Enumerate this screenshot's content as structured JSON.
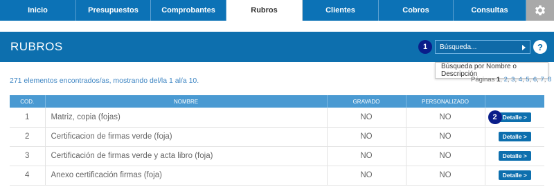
{
  "nav": {
    "tabs": [
      {
        "label": "Inicio"
      },
      {
        "label": "Presupuestos"
      },
      {
        "label": "Comprobantes"
      },
      {
        "label": "Rubros"
      },
      {
        "label": "Clientes"
      },
      {
        "label": "Cobros"
      },
      {
        "label": "Consultas"
      }
    ],
    "active_tab": "Rubros",
    "settings_icon": "gear-icon"
  },
  "header": {
    "title": "RUBROS",
    "badge_1": "1",
    "search_label": "Búsqueda...",
    "help_label": "?"
  },
  "dropdown": {
    "option": "Búsqueda por Nombre o Descripción"
  },
  "summary": "271 elementos encontrados/as, mostrando del/la 1 al/a 10.",
  "pagination": {
    "label": "Páginas",
    "current": "1",
    "pages": [
      "2",
      "3",
      "4",
      "5",
      "6",
      "7",
      "8"
    ]
  },
  "table": {
    "columns": [
      "COD.",
      "NOMBRE",
      "GRAVADO",
      "PERSONALIZADO",
      ""
    ],
    "rows": [
      {
        "cod": "1",
        "nombre": "Matriz, copia (fojas)",
        "gravado": "NO",
        "personalizado": "NO",
        "action": "Detalle >"
      },
      {
        "cod": "2",
        "nombre": "Certificacion de firmas verde (foja)",
        "gravado": "NO",
        "personalizado": "NO",
        "action": "Detalle >"
      },
      {
        "cod": "3",
        "nombre": "Certificación de firmas verde y acta libro (foja)",
        "gravado": "NO",
        "personalizado": "NO",
        "action": "Detalle >"
      },
      {
        "cod": "4",
        "nombre": "Anexo certificación firmas (foja)",
        "gravado": "NO",
        "personalizado": "NO",
        "action": "Detalle >"
      }
    ],
    "badge_2": "2"
  },
  "colors": {
    "nav_blue": "#0c72b6",
    "header_blue": "#0d6fae",
    "table_header_blue": "#4a9ad2",
    "badge_navy": "#0a1d8a",
    "link_blue": "#3a83c2"
  }
}
